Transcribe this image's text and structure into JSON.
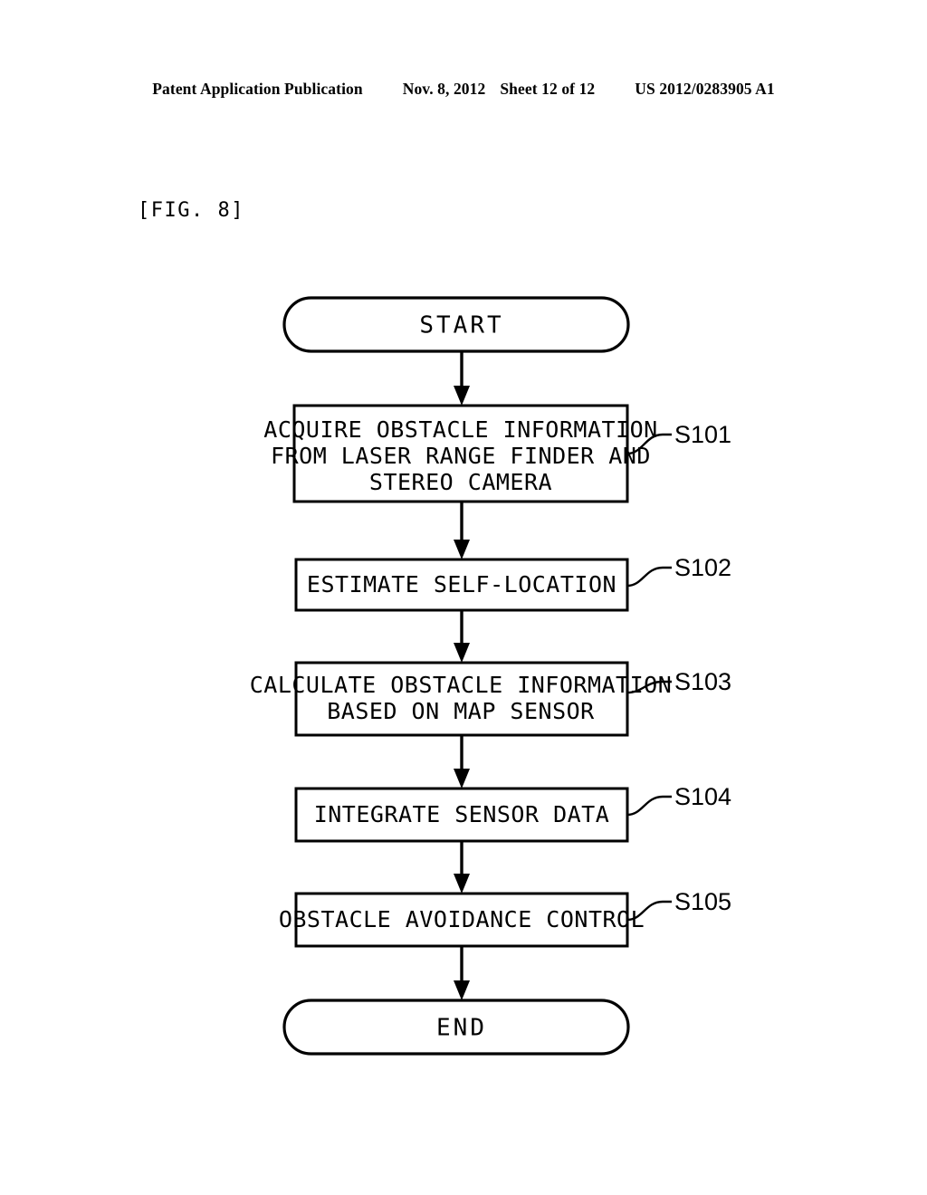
{
  "header": {
    "publication": "Patent Application Publication",
    "date": "Nov. 8, 2012",
    "sheet": "Sheet 12 of 12",
    "patent_number": "US 2012/0283905 A1"
  },
  "figure": {
    "label": "[FIG. 8]",
    "type": "flowchart"
  },
  "flowchart": {
    "start": {
      "label": "START",
      "shape": "terminator"
    },
    "end": {
      "label": "END",
      "shape": "terminator"
    },
    "steps": [
      {
        "id": "S101",
        "shape": "process",
        "lines": [
          "ACQUIRE OBSTACLE INFORMATION",
          "FROM LASER RANGE FINDER AND",
          "STEREO CAMERA"
        ]
      },
      {
        "id": "S102",
        "shape": "process",
        "lines": [
          "ESTIMATE SELF-LOCATION"
        ]
      },
      {
        "id": "S103",
        "shape": "process",
        "lines": [
          "CALCULATE OBSTACLE INFORMATION",
          "BASED ON MAP SENSOR"
        ]
      },
      {
        "id": "S104",
        "shape": "process",
        "lines": [
          "INTEGRATE SENSOR DATA"
        ]
      },
      {
        "id": "S105",
        "shape": "process",
        "lines": [
          "OBSTACLE AVOIDANCE CONTROL"
        ]
      }
    ],
    "flow_order": [
      "START",
      "S101",
      "S102",
      "S103",
      "S104",
      "S105",
      "END"
    ],
    "colors": {
      "stroke": "#000000",
      "fill": "#ffffff",
      "text": "#000000"
    }
  }
}
